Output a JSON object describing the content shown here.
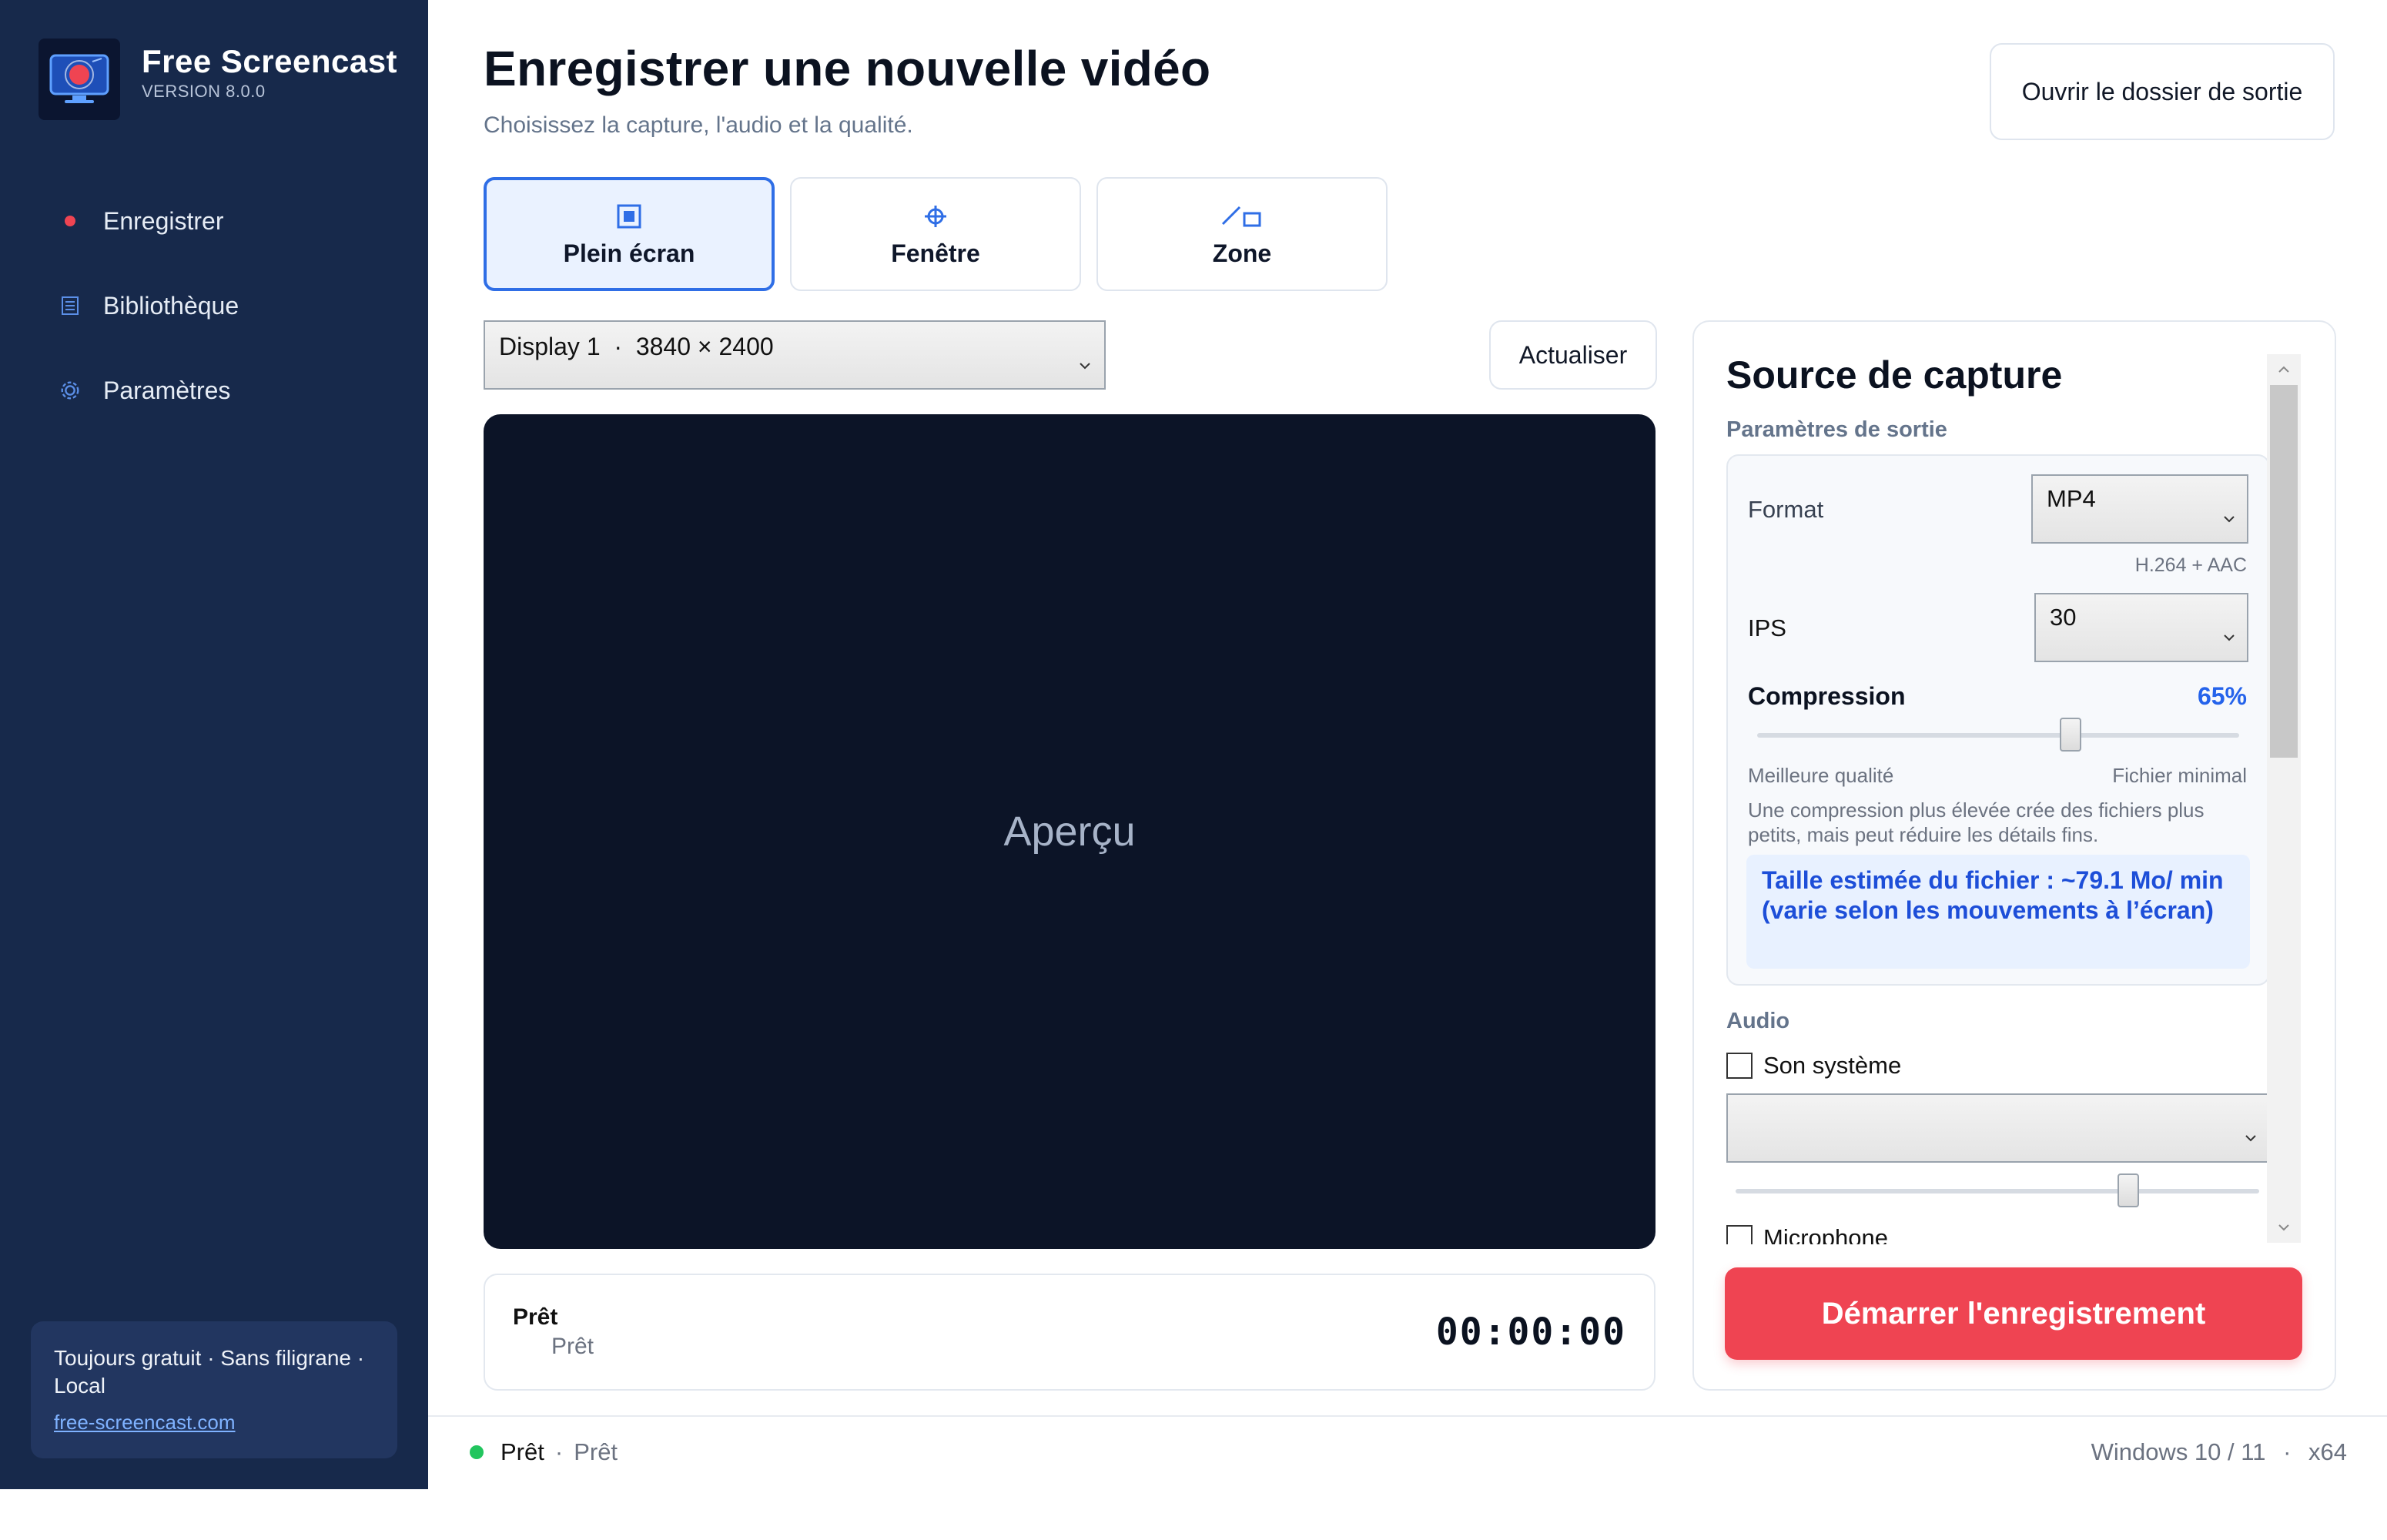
{
  "app": {
    "name": "Free Screencast",
    "version": "VERSION 8.0.0"
  },
  "sidebar": {
    "items": [
      {
        "label": "Enregistrer",
        "icon": "record-dot-icon"
      },
      {
        "label": "Bibliothèque",
        "icon": "library-icon"
      },
      {
        "label": "Paramètres",
        "icon": "gear-icon"
      }
    ],
    "promo": {
      "text": "Toujours gratuit · Sans filigrane · Local",
      "link": "free-screencast.com"
    }
  },
  "header": {
    "title": "Enregistrer une nouvelle vidéo",
    "subtitle": "Choisissez la capture, l'audio et la qualité.",
    "open_folder": "Ouvrir le dossier de sortie"
  },
  "modes": {
    "selected": "Plein écran",
    "tabs": [
      {
        "label": "Plein écran",
        "icon": "fullscreen-icon"
      },
      {
        "label": "Fenêtre",
        "icon": "crosshair-icon"
      },
      {
        "label": "Zone",
        "icon": "region-icon"
      }
    ]
  },
  "display_select": {
    "value": "Display 1  ·  3840 × 2400"
  },
  "refresh_label": "Actualiser",
  "preview": {
    "label": "Aperçu"
  },
  "status_card": {
    "title": "Prêt",
    "subtitle": "Prêt",
    "timer": "00:00:00"
  },
  "panel": {
    "title": "Source de capture",
    "output_section": "Paramètres de sortie",
    "format": {
      "label": "Format",
      "value": "MP4",
      "codec": "H.264 + AAC"
    },
    "fps": {
      "label": "IPS",
      "value": "30"
    },
    "compression": {
      "label": "Compression",
      "value_text": "65%",
      "value": 0.65,
      "min_label": "Meilleure qualité",
      "max_label": "Fichier minimal",
      "description": "Une compression plus élevée crée des fichiers plus petits, mais peut réduire les détails fins.",
      "estimate": "Taille estimée du fichier : ~79.1 Mo/ min (varie selon les mouvements à l’écran)"
    },
    "audio_section": "Audio",
    "system_sound": {
      "label": "Son système",
      "checked": false,
      "device": "",
      "volume": 0.75
    },
    "microphone": {
      "label": "Microphone",
      "checked": false
    }
  },
  "start_button": "Démarrer l'enregistrement",
  "status_bar": {
    "state": "Prêt",
    "detail": "Prêt",
    "platform": "Windows 10 / 11",
    "arch": "x64"
  },
  "colors": {
    "sidebar": "#17294b",
    "accent": "#2f6ee6",
    "record": "#ef4452",
    "ok": "#22c55e"
  }
}
